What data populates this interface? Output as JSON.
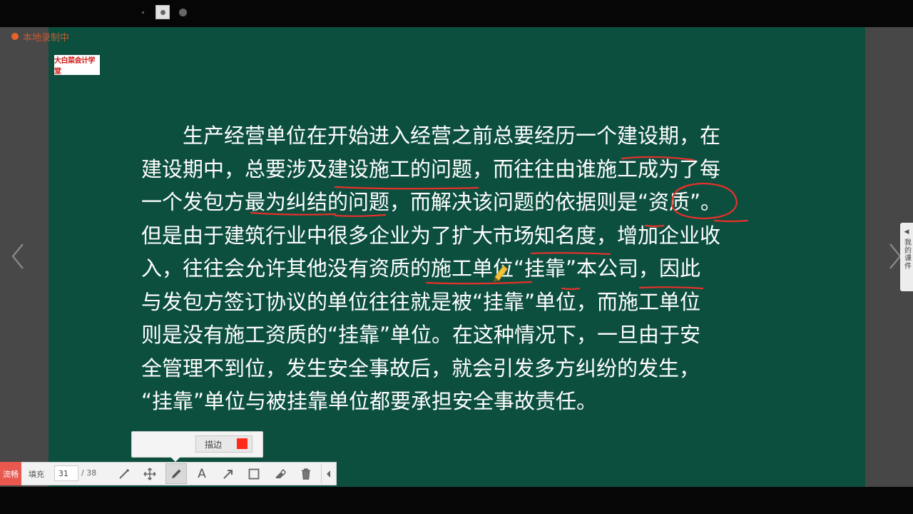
{
  "recording": {
    "status_text": "本地录制中",
    "dot_color": "#e8632a"
  },
  "logo": {
    "text": "大白菜会计学堂"
  },
  "slide": {
    "background": "#0c4f3f",
    "text_color": "#ffffff",
    "lines": [
      "　　生产经营单位在开始进入经营之前总要经历一个建设期，在",
      "建设期中，总要涉及建设施工的问题，而往往由谁施工成为了每",
      "一个发包方最为纠结的问题，而解决该问题的依据则是“资质”。",
      "但是由于建筑行业中很多企业为了扩大市场知名度，增加企业收",
      "入，往往会允许其他没有资质的施工单位“挂靠”本公司，因此",
      "与发包方签订协议的单位往往就是被“挂靠”单位，而施工单位",
      "则是没有施工资质的“挂靠”单位。在这种情况下，一旦由于安",
      "全管理不到位，发生安全事故后，就会引发多方纠纷的发生，",
      "“挂靠”单位与被挂靠单位都要承担安全事故责任。"
    ]
  },
  "annotations": {
    "ink_color": "#e8302a"
  },
  "side_panel": {
    "label": "我的课件"
  },
  "pen_popup": {
    "stroke_label": "描边",
    "stroke_color": "#ff2a1a"
  },
  "toolbar": {
    "flow_label": "流畅",
    "fill_label": "填充",
    "current_page": "31",
    "total_pages": "/ 38",
    "text_tool_glyph": "A"
  }
}
